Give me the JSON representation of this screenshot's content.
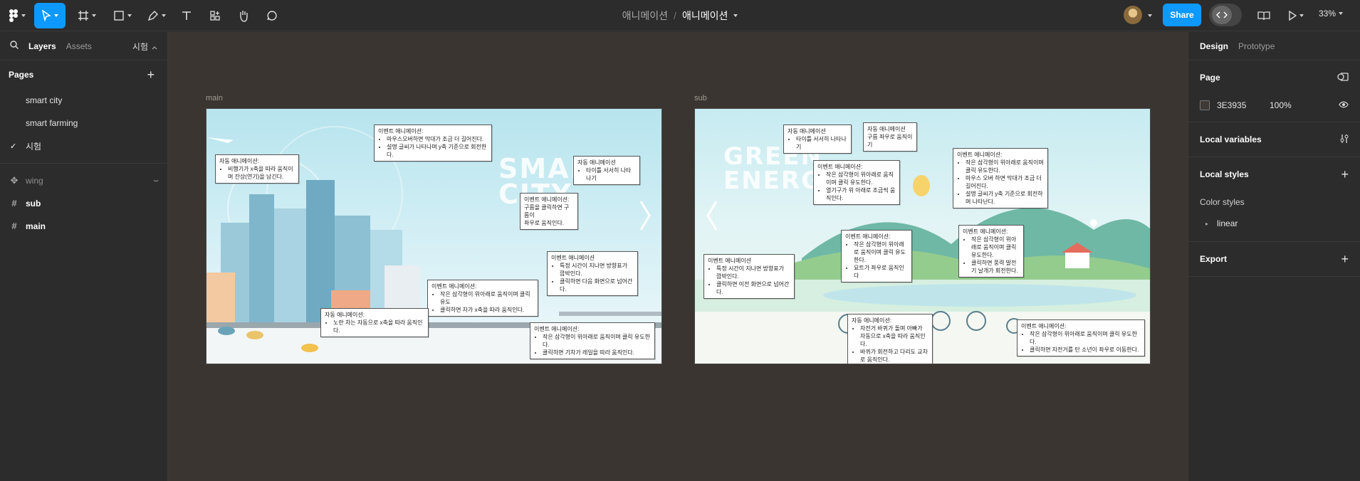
{
  "toolbar": {
    "tools": [
      "main-menu",
      "move",
      "frame",
      "shape",
      "pen",
      "text",
      "resources",
      "hand",
      "comment"
    ],
    "breadcrumb": {
      "project": "애니메이션",
      "separator": "/",
      "file": "애니메이션"
    },
    "share_label": "Share",
    "zoom": "33%",
    "accent": "#0d99ff"
  },
  "left_panel": {
    "tabs": [
      "Layers",
      "Assets"
    ],
    "page_selector": "시험",
    "pages_title": "Pages",
    "pages": [
      {
        "label": "smart city",
        "selected": false
      },
      {
        "label": "smart farming",
        "selected": false
      },
      {
        "label": "시험",
        "selected": true
      }
    ],
    "layers": [
      {
        "label": "wing",
        "icon": "component-icon",
        "style": "dim"
      },
      {
        "label": "sub",
        "icon": "frame-icon",
        "style": "bold"
      },
      {
        "label": "main",
        "icon": "frame-icon",
        "style": "bold"
      }
    ]
  },
  "canvas": {
    "background": "#3e3935",
    "frames": [
      {
        "label": "main",
        "big_text": "SMART CITY",
        "notes": [
          {
            "title": "이벤트 애니메이션:",
            "items": [
              "마우스오버하면 막대가 조금 더 길어진다.",
              "설명 글씨가 나타나며 y축 기준으로 회전한다."
            ]
          },
          {
            "title": "자동 애니메이션:",
            "items": [
              "비행기가 x축을 따라 움직이며 잔상(연기)을 남긴다."
            ]
          },
          {
            "title": "자동 애니메이션",
            "items": [
              "타이틀 서서히 나타나기"
            ]
          },
          {
            "title": "이벤트 애니메이션:",
            "lines": [
              "구름을 클릭하면 구름이",
              "좌우로 움직인다."
            ]
          },
          {
            "title": "이벤트 애니메이션",
            "items": [
              "특정 시간이 지나면 방향표가 깜박인다.",
              "클릭하면 다음 화면으로 넘어간다."
            ]
          },
          {
            "title": "이벤트 애니메이션:",
            "items": [
              "작은 삼각형이 위아래로 움직이며 클릭 유도",
              "클릭하면 차가 x축을 따라 움직인다."
            ]
          },
          {
            "title": "자동 애니메이션:",
            "items": [
              "노란 차는 자동으로 x축을 따라 움직인다."
            ]
          },
          {
            "title": "이벤트 애니메이션:",
            "items": [
              "작은 삼각형이 위아래로 움직이며 클릭 유도한다.",
              "클릭하면 기차가 레일을 따라 움직인다."
            ]
          }
        ]
      },
      {
        "label": "sub",
        "big_text": "GREEN ENERGY",
        "notes": [
          {
            "title": "자동 애니메이션",
            "items": [
              "타이틀 서서히 나타나기"
            ]
          },
          {
            "title": "자동 애니메이션",
            "lines": [
              "구름 좌우로 움직이기"
            ]
          },
          {
            "title": "이벤트 애니메이션:",
            "items": [
              "작은 삼각형이 위아래로 움직이며 클릭 유도한다.",
              "열기구가 위 아래로 조금씩 움직인다."
            ]
          },
          {
            "title": "이벤트 애니메이션:",
            "items": [
              "작은 삼각형이 위아래로 움직이며 클릭 유도한다.",
              "마우스 오버 하면 막대가 조금 더 길어진다.",
              "설명 글씨가 y축 기준으로 회전하며 나타난다."
            ]
          },
          {
            "title": "이벤트 애니메이션:",
            "items": [
              "작은 삼각형이 위아래로 움직이며 클릭 유도한다.",
              "요트가 좌우로 움직인다"
            ]
          },
          {
            "title": "이벤트 애니메이션:",
            "items": [
              "작은 삼각형이 위아래로 움직이며 클릭 유도한다.",
              "클릭하면 풍력 발전기 날개가 회전한다."
            ]
          },
          {
            "title": "이벤트 애니메이션",
            "items": [
              "특정 시간이 지나면 방향표가 깜박인다.",
              "클릭하면 이전 화면으로 넘어간다."
            ]
          },
          {
            "title": "자동 애니메이션:",
            "items": [
              "자전거 바퀴가 돌며 아빠가 자동으로 x축을 따라 움직인다.",
              "바퀴가 회전하고 다리도 교차로 움직인다."
            ]
          },
          {
            "title": "이벤트 애니메이션:",
            "items": [
              "작은 삼각형이 위아래로 움직이며 클릭 유도한다.",
              "클릭하면 자전거를 탄 소년이 좌우로 이동한다."
            ]
          }
        ]
      }
    ]
  },
  "right_panel": {
    "tabs": [
      "Design",
      "Prototype"
    ],
    "page_title": "Page",
    "page_color": "3E3935",
    "page_opacity": "100%",
    "local_variables": "Local variables",
    "local_styles": "Local styles",
    "color_styles": "Color styles",
    "color_style_items": [
      "linear"
    ],
    "export": "Export"
  }
}
